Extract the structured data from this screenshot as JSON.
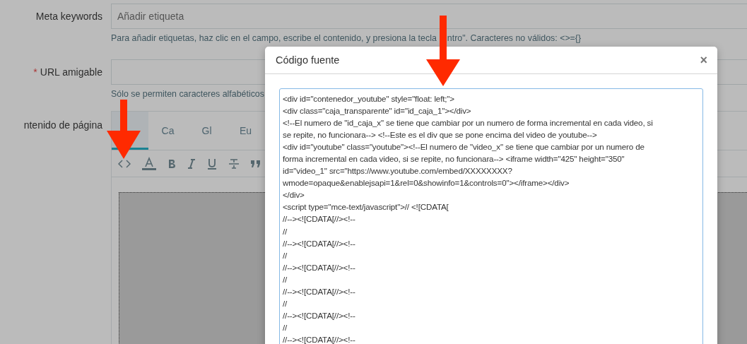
{
  "form": {
    "rows": [
      {
        "label": "Meta keywords",
        "placeholder": "Añadir etiqueta",
        "hint": [
          "Para añadir etiquetas, haz clic en el campo, escribe el contenido, y presiona la tecla",
          "ntro\". Caracteres no válidos: <>={}"
        ]
      },
      {
        "label": "URL amigable",
        "required_mark": "*",
        "hint": [
          "Sólo se permiten caracteres alfabéticos"
        ]
      }
    ],
    "content_label": "ntenido de página",
    "language_tabs": [
      {
        "selected": true
      },
      {
        "label": "Ca",
        "selected": false
      },
      {
        "label": "Gl",
        "selected": false
      },
      {
        "label": "Eu",
        "selected": false
      }
    ]
  },
  "modal": {
    "title": "Código fuente",
    "close": "×",
    "code_lines": [
      "<div id=\"contenedor_youtube\" style=\"float: left;\">",
      "<div class=\"caja_transparente\" id=\"id_caja_1\"></div>",
      "<!--El numero de \"id_caja_x\" se tiene que cambiar por un numero de forma incremental en cada video, si",
      "se repite, no funcionara--> <!--Este es el div que se pone encima del video de youtube-->",
      "<div id=\"youtube\" class=\"youtube\"><!--El numero de \"video_x\" se tiene que cambiar por un numero de",
      "forma incremental en cada video, si se repite, no funcionara--> <iframe width=\"425\" height=\"350\"",
      "id=\"video_1\" src=\"https://www.youtube.com/embed/XXXXXXXX?",
      "wmode=opaque&enablejsapi=1&rel=0&showinfo=1&controls=0\"></iframe></div>",
      "</div>",
      "<script type=\"mce-text/javascript\">// <![CDATA[",
      "//--><![CDATA[//><!--",
      "//",
      "//--><![CDATA[//><!--",
      "//",
      "//--><![CDATA[//><!--",
      "//",
      "//--><![CDATA[//><!--",
      "//",
      "//--><![CDATA[//><!--",
      "//",
      "//--><![CDATA[//><!--"
    ]
  }
}
